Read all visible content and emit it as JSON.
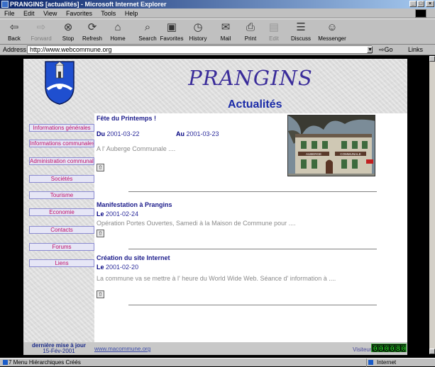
{
  "window": {
    "title": "PRANGINS [actualités] - Microsoft Internet Explorer"
  },
  "menu": [
    "File",
    "Edit",
    "View",
    "Favorites",
    "Tools",
    "Help"
  ],
  "toolbar": {
    "back": "Back",
    "forward": "Forward",
    "stop": "Stop",
    "refresh": "Refresh",
    "home": "Home",
    "search": "Search",
    "favorites": "Favorites",
    "history": "History",
    "mail": "Mail",
    "print": "Print",
    "edit": "Edit",
    "discuss": "Discuss",
    "messenger": "Messenger"
  },
  "address": {
    "label": "Address",
    "url": "http://www.webcommune.org",
    "go": "Go",
    "links": "Links"
  },
  "site": {
    "logo": "PRANGINS",
    "subtitle": "Actualités"
  },
  "nav": [
    "Informations générales",
    "Informations communales",
    "Administration communale",
    "Sociétés",
    "Tourisme",
    "Economie",
    "Contacts",
    "Forums",
    "Liens"
  ],
  "articles": [
    {
      "title": "Fête du Printemps !",
      "from_label": "Du",
      "from": "2001-03-22",
      "to_label": "Au",
      "to": "2001-03-23",
      "text": "A l' Auberge Communale ...."
    },
    {
      "title": "Manifestation à Prangins",
      "from_label": "Le",
      "from": "2001-02-24",
      "text": "Opération Portes Ouvertes, Samedi à la Maison de Commune pour ...."
    },
    {
      "title": "Création du site Internet",
      "from_label": "Le",
      "from": "2001-02-20",
      "text": "La commune va se mettre à l' heure du World Wide Web. Séance d' information à ...."
    }
  ],
  "photo_signs": {
    "auberge": "AUBERGE",
    "communale": "COMMUNALE"
  },
  "footer": {
    "updated_label": "dernière mise à jour",
    "updated_date": "15-Fév-2001",
    "link": "www.macommune.org",
    "visitors_label": "Visiteurs",
    "counter": "000080"
  },
  "status": {
    "left": "7 Menu Hiérarchiques Créés",
    "zone": "Internet"
  }
}
